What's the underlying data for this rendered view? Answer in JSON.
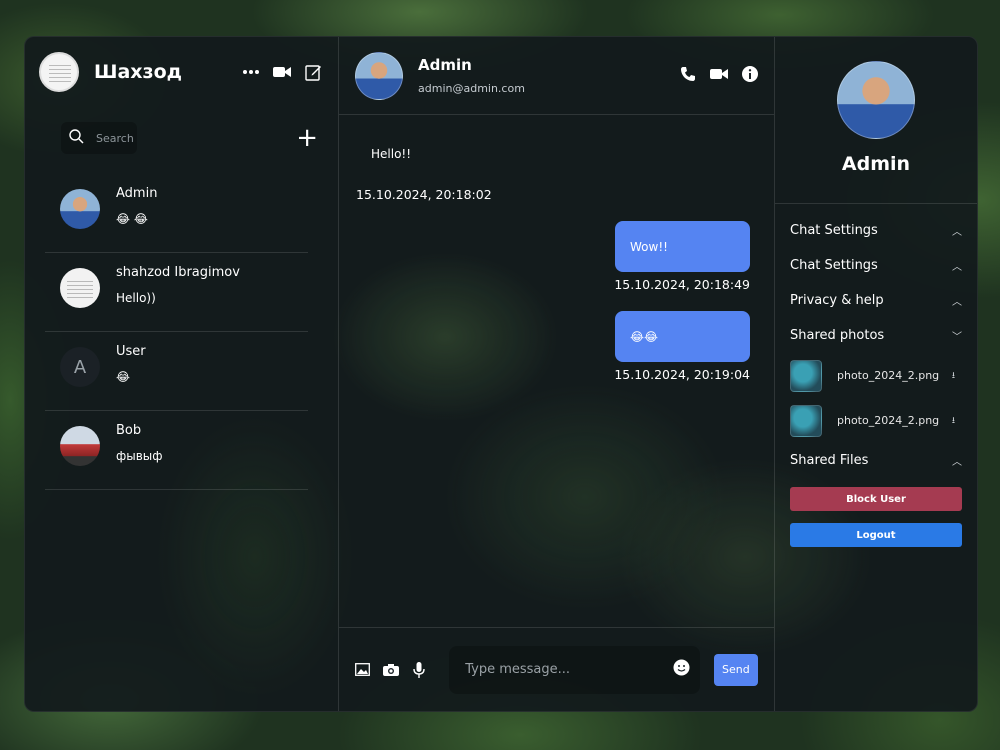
{
  "current_user": {
    "name": "Шахзод"
  },
  "search": {
    "placeholder": "Search"
  },
  "contacts": [
    {
      "name": "Admin",
      "last_message": "😂 😂",
      "avatar": "photo"
    },
    {
      "name": "shahzod Ibragimov",
      "last_message": "Hello))",
      "avatar": "document"
    },
    {
      "name": "User",
      "last_message": "😂",
      "avatar": "letter",
      "initial": "A"
    },
    {
      "name": "Bob",
      "last_message": "фывыф",
      "avatar": "car"
    }
  ],
  "chat": {
    "name": "Admin",
    "email": "admin@admin.com",
    "messages": [
      {
        "direction": "in",
        "text": "Hello!!",
        "time": "15.10.2024, 20:18:02"
      },
      {
        "direction": "out",
        "text": "Wow!!",
        "time": "15.10.2024, 20:18:49"
      },
      {
        "direction": "out",
        "text": "😂😂",
        "time": "15.10.2024, 20:19:04"
      }
    ]
  },
  "composer": {
    "placeholder": "Type message...",
    "send_label": "Send"
  },
  "details": {
    "name": "Admin",
    "menu": [
      "Chat Settings",
      "Chat Settings",
      "Privacy & help",
      "Shared photos"
    ],
    "shared_photos": [
      {
        "name": "photo_2024_2.png"
      },
      {
        "name": "photo_2024_2.png"
      }
    ],
    "shared_files_label": "Shared Files",
    "block_label": "Block User",
    "logout_label": "Logout"
  },
  "colors": {
    "accent": "#5584f2",
    "block": "#a53b51",
    "logout": "#2a7ae6"
  }
}
